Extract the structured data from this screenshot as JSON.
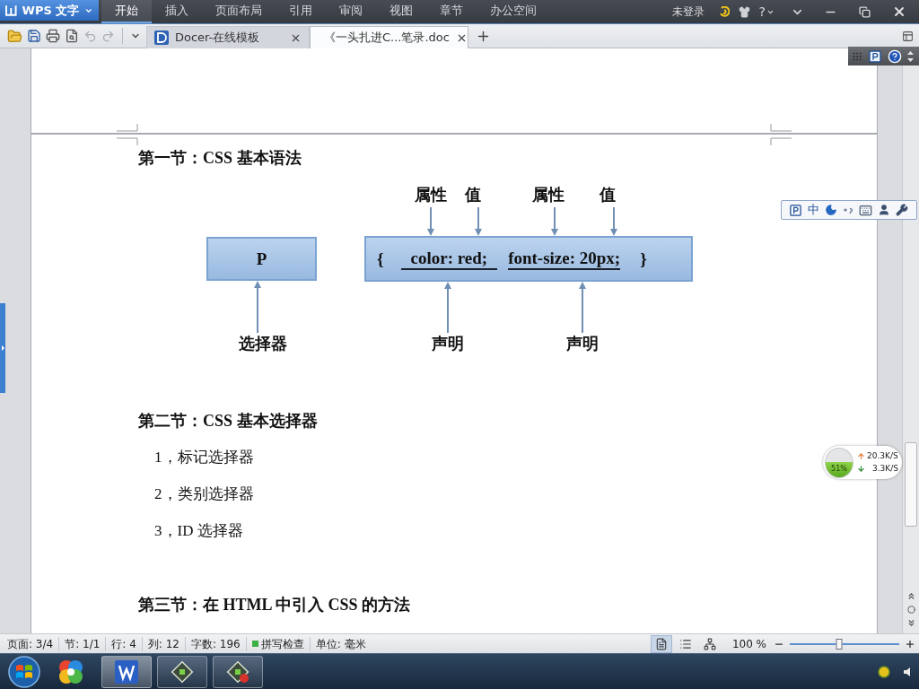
{
  "title_bar": {
    "app_name": "WPS 文字",
    "menu": [
      {
        "label": "开始",
        "selected": true
      },
      {
        "label": "插入",
        "selected": false
      },
      {
        "label": "页面布局",
        "selected": false
      },
      {
        "label": "引用",
        "selected": false
      },
      {
        "label": "审阅",
        "selected": false
      },
      {
        "label": "视图",
        "selected": false
      },
      {
        "label": "章节",
        "selected": false
      },
      {
        "label": "办公空间",
        "selected": false
      }
    ],
    "account": "未登录",
    "help": "?"
  },
  "tab_bar": {
    "tabs": [
      {
        "kind": "docer",
        "title": "Docer-在线模板",
        "selected": false
      },
      {
        "kind": "doc",
        "title": "《一头扎进C...笔录.doc",
        "selected": true
      }
    ]
  },
  "document": {
    "blocks": [
      {
        "kind": "heading",
        "text": "第一节：CSS 基本语法"
      },
      {
        "kind": "diagram",
        "selector": "P",
        "selector_label": "选择器",
        "open_brace": "{",
        "close_brace": "}",
        "declarations": [
          {
            "text": "color: red;",
            "property_label": "属性",
            "value_label": "值",
            "label": "声明"
          },
          {
            "text": "font-size: 20px;",
            "property_label": "属性",
            "value_label": "值",
            "label": "声明"
          }
        ]
      },
      {
        "kind": "heading",
        "text": "第二节：CSS 基本选择器"
      },
      {
        "kind": "item",
        "text": "1，标记选择器"
      },
      {
        "kind": "item",
        "text": "2，类别选择器"
      },
      {
        "kind": "item",
        "text": "3，ID 选择器"
      },
      {
        "kind": "heading",
        "text": "第三节：在 HTML 中引入 CSS 的方法"
      }
    ]
  },
  "ime_bar": {
    "mode": "中"
  },
  "net_monitor": {
    "usage": "51%",
    "level": 0.51,
    "upload": "20.3K/S",
    "download": "3.3K/S"
  },
  "status_bar": {
    "fields": [
      "页面: 3/4",
      "节: 1/1",
      "行: 4",
      "列: 12",
      "字数: 196"
    ],
    "spell_check": {
      "label": "拼写检查",
      "on": true
    },
    "unit": "单位: 毫米",
    "views": [
      {
        "kind": "page",
        "selected": true
      },
      {
        "kind": "outline",
        "selected": false
      },
      {
        "kind": "web",
        "selected": false
      }
    ],
    "zoom": {
      "reading": "100 %",
      "level": 0.45
    }
  },
  "taskbar": {
    "apps": [
      {
        "kind": "pinwheel",
        "running": false,
        "selected": false
      },
      {
        "kind": "wps",
        "running": true,
        "selected": true
      },
      {
        "kind": "diamond",
        "running": true,
        "selected": false
      },
      {
        "kind": "diamond-badge",
        "running": true,
        "selected": false
      }
    ]
  }
}
